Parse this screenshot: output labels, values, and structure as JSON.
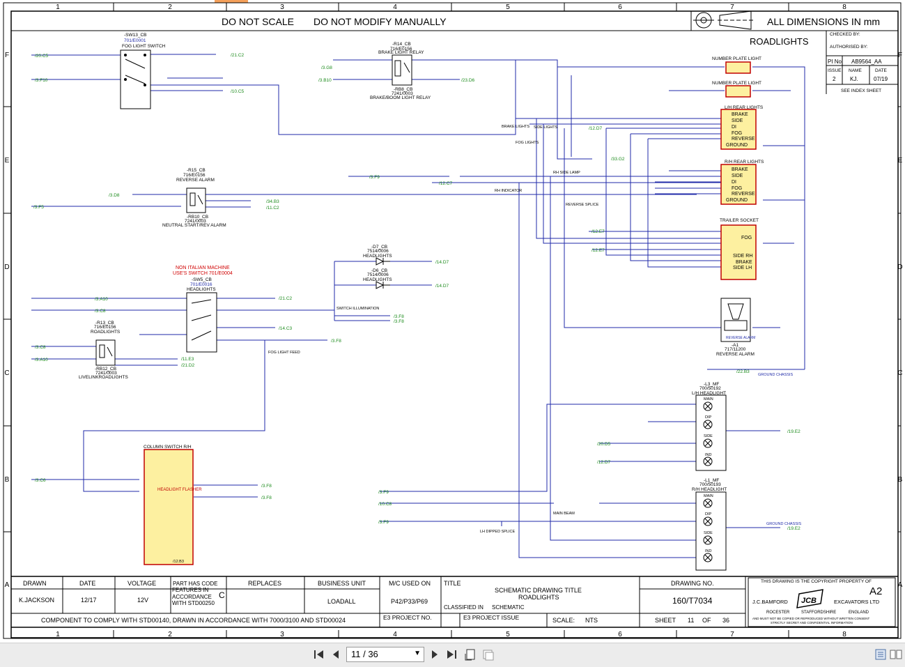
{
  "header": {
    "no_scale": "DO NOT SCALE",
    "no_modify": "DO NOT MODIFY MANUALLY",
    "dimensions": "ALL DIMENSIONS IN mm",
    "sheet_title": "ROADLIGHTS"
  },
  "grid": {
    "columns": [
      "1",
      "2",
      "3",
      "4",
      "5",
      "6",
      "7",
      "8"
    ],
    "rows": [
      "F",
      "E",
      "D",
      "C",
      "B",
      "A"
    ]
  },
  "revision_box": {
    "checked_by": "CHECKED BY:",
    "authorised_by": "AUTHORISED BY:",
    "pi_no_label": "PI No",
    "pi_no": "AB9564_AA",
    "issue_label": "ISSUE",
    "name_label": "NAME",
    "date_label": "DATE",
    "issue": "2",
    "name": "KJ.",
    "date": "07/19",
    "index_note": "SEE INDEX SHEET"
  },
  "components": {
    "sw13": {
      "ref": "-SW13_CB",
      "part": "701/E0001",
      "title": "FOG LIGHT SWITCH"
    },
    "r14": {
      "ref": "-R14_CB",
      "part": "716/E0156",
      "title": "BRAKE LIGHT RELAY"
    },
    "rb8": {
      "ref": "-RB8_CB",
      "part": "7241/0003",
      "title": "BRAKE/BOOM LIGHT RELAY"
    },
    "number_plate": "NUMBER PLATE LIGHT",
    "lh_rear": {
      "title": "L/H REAR LIGHTS",
      "items": [
        "BRAKE",
        "SIDE",
        "DI",
        "FOG",
        "REVERSE",
        "GROUND"
      ]
    },
    "rh_rear": {
      "title": "R/H REAR LIGHTS",
      "items": [
        "BRAKE",
        "SIDE",
        "DI",
        "FOG",
        "REVERSE",
        "GROUND"
      ]
    },
    "trailer": {
      "title": "TRAILER SOCKET",
      "items": [
        "FOG",
        "SIDE RH",
        "BRAKE",
        "SIDE LH"
      ]
    },
    "r15": {
      "ref": "-R15_CB",
      "part": "716/E0156",
      "title": "REVERSE ALARM"
    },
    "rb10": {
      "ref": "-RB10_CB",
      "part": "7241/0003",
      "title": "NEUTRAL START/REV ALARM"
    },
    "d7": {
      "ref": "-D7_CB",
      "part": "7514/0006",
      "title": "HEADLIGHTS"
    },
    "d6": {
      "ref": "-D6_CB",
      "part": "7514/0006",
      "title": "HEADLIGHTS"
    },
    "non_italian": "NON ITALIAN MACHINE",
    "use_switch": "USE'S SWITCH 701/E0004",
    "sw5": {
      "ref": "-SW5_CB",
      "part": "701/E0016",
      "title": "HEADLIGHTS"
    },
    "r13": {
      "ref": "-R13_CB",
      "part": "716/E0156",
      "title": "ROADLIGHTS"
    },
    "rb12": {
      "ref": "-RB12_CB",
      "part": "7241/0003",
      "title": "LIVELINKROADLIGHTS"
    },
    "reverse_alarm": {
      "title": "REVERSE ALARM",
      "ref": "-A1",
      "part": "717/11200"
    },
    "lh_headlight": {
      "ref": "-L3_MF",
      "part": "700/50192",
      "title": "L/H HEADLIGHT",
      "items": [
        "MAIN",
        "DIP",
        "SIDE",
        "IND"
      ]
    },
    "rh_headlight": {
      "ref": "-L1_MF",
      "part": "700/50193",
      "title": "R/H HEADLIGHT",
      "items": [
        "MAIN",
        "DIP",
        "SIDE",
        "IND"
      ]
    },
    "column_switch": {
      "title": "COLUMN SWITCH R/H",
      "inner": "HEADLIGHT FLASHER",
      "ref": "/12.B3"
    }
  },
  "notes": {
    "fog_light_feed": "FOG LIGHT FEED",
    "switch_illumination": "SWITCH ILLUMINATION",
    "brake_lights": "BRAKE LIGHTS",
    "side_lights": "SIDE LIGHTS",
    "fog_lights": "FOG LIGHTS",
    "rh_side_lamp": "RH SIDE LAMP",
    "rh_indicator": "RH INDICATOR",
    "reverse_splice": "REVERSE SPLICE",
    "main_beam": "MAIN BEAM",
    "lh_dipped_splice": "LH DIPPED SPLICE",
    "ground_chassis": "GROUND CHASSIS"
  },
  "xrefs": [
    "/20.C5",
    "/3.F10",
    "/21.C2",
    "/10.C5",
    "/3.G8",
    "/3.B10",
    "/23.D6",
    "/12.D7",
    "/33.G2",
    "/3.F9",
    "/12.C7",
    "/3.D8",
    "/3.F5",
    "/34.B3",
    "/11.C2",
    "/14.D7",
    "/3.A10",
    "/3.C8",
    "/21.C2",
    "/14.C3",
    "/3.F8",
    "/11.E3",
    "/21.D2",
    "/12.E7",
    "/22.B3",
    "/19.E2",
    "/20.D5",
    "/3.C6",
    "/10.C8"
  ],
  "title_block": {
    "drawn_label": "DRAWN",
    "drawn": "K.JACKSON",
    "date_label": "DATE",
    "date": "12/17",
    "voltage_label": "VOLTAGE",
    "voltage": "12V",
    "part_code_label": "PART HAS CODE",
    "part_code_text": "FEATURES IN ACCORDANCE WITH STD00250",
    "part_code": "C",
    "replaces_label": "REPLACES",
    "business_unit_label": "BUSINESS UNIT",
    "business_unit": "LOADALL",
    "mc_used_label": "M/C USED ON",
    "mc_used": "P42/P33/P69",
    "title_label": "TITLE",
    "title_line1": "SCHEMATIC DRAWING TITLE",
    "title_line2": "ROADLIGHTS",
    "classified_label": "CLASSIFIED IN",
    "classified": "SCHEMATIC",
    "drawing_no_label": "DRAWING NO.",
    "drawing_no": "160/T7034",
    "compliance": "COMPONENT TO COMPLY WITH STD00140, DRAWN IN ACCORDANCE WITH 7000/3100 AND STD00024",
    "e3_project_no_label": "E3 PROJECT NO.",
    "e3_project_issue_label": "E3 PROJECT ISSUE",
    "scale_label": "SCALE:",
    "scale": "NTS",
    "sheet_label": "SHEET",
    "sheet": "11",
    "of_label": "OF",
    "of": "36",
    "copyright": "THIS DRAWING IS THE COPYRIGHT PROPERTY OF",
    "size": "A2",
    "company_left": "J.C.BAMFORD",
    "company_right": "EXCAVATORS LTD",
    "logo": "JCB",
    "addr1": "ROCESTER",
    "addr2": "STAFFORDSHIRE",
    "addr3": "ENGLAND",
    "confidential1": "AND MUST NOT BE COPIED OR REPRODUCED WITHOUT WRITTEN CONSENT",
    "confidential2": "STRICTLY SECRET AND CONFIDENTIAL INFORMATION"
  },
  "viewer": {
    "page_value": "11 / 36",
    "icons": [
      "first-page-icon",
      "prev-page-icon",
      "next-page-icon",
      "last-page-icon",
      "fit-page-icon",
      "fit-width-icon",
      "single-page-icon",
      "facing-pages-icon"
    ]
  }
}
